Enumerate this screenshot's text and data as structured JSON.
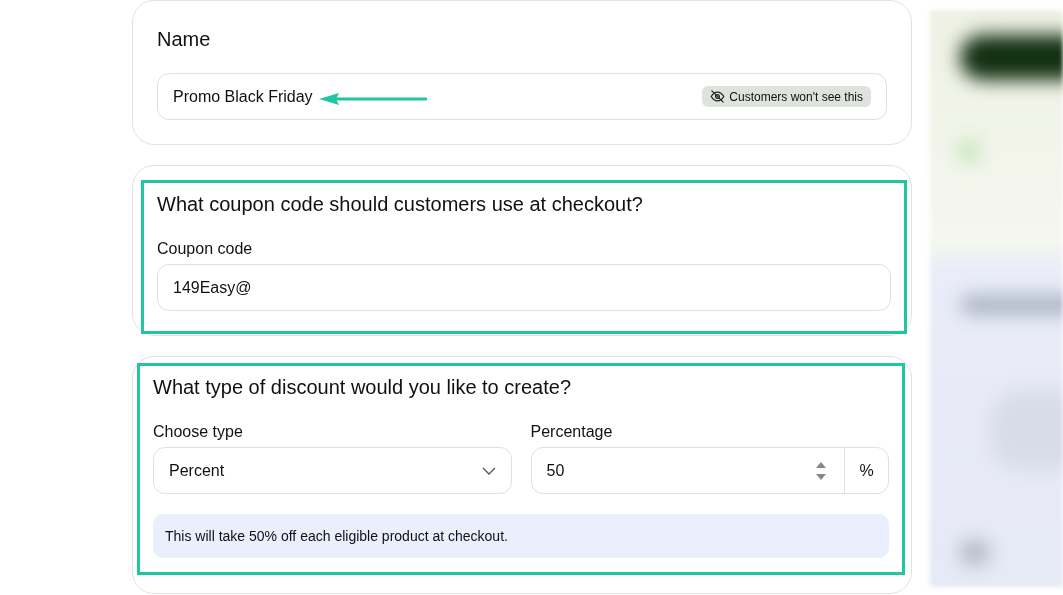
{
  "name_section": {
    "title": "Name",
    "field": {
      "value": "Promo Black Friday"
    },
    "badge": "Customers won't see this",
    "annotation_arrow": true
  },
  "coupon_section": {
    "highlighted": true,
    "title": "What coupon code should customers use at checkout?",
    "field_label": "Coupon code",
    "field": {
      "value": "149Easy@"
    }
  },
  "discount_section": {
    "highlighted": true,
    "title": "What type of discount would you like to create?",
    "type_field": {
      "label": "Choose type",
      "value": "Percent"
    },
    "percentage_field": {
      "label": "Percentage",
      "value": "50",
      "unit": "%"
    },
    "note": "This will take 50% off each eligible product at checkout."
  }
}
